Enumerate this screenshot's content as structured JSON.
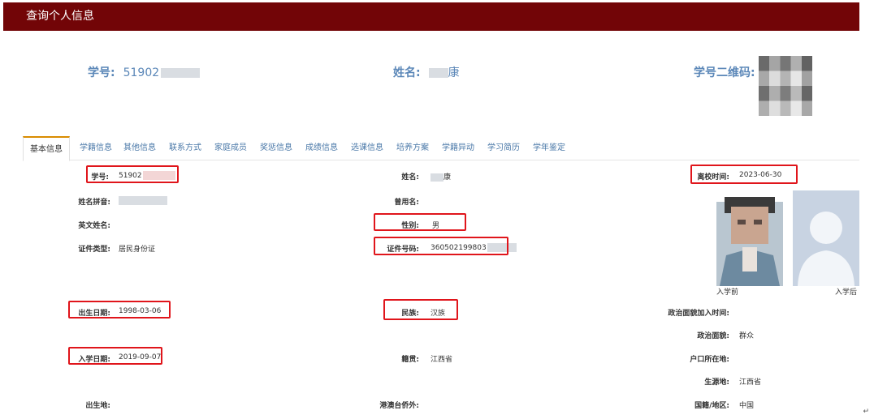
{
  "title": "查询个人信息",
  "header": {
    "student_id_label": "学号:",
    "student_id_value": "51902",
    "name_label": "姓名:",
    "name_value": "康",
    "qr_label": "学号二维码:"
  },
  "tabs": [
    "基本信息",
    "学籍信息",
    "其他信息",
    "联系方式",
    "家庭成员",
    "奖惩信息",
    "成绩信息",
    "选课信息",
    "培养方案",
    "学籍异动",
    "学习简历",
    "学年鉴定"
  ],
  "fields": {
    "student_id": {
      "label": "学号:",
      "value": "51902"
    },
    "name": {
      "label": "姓名:",
      "value": "康"
    },
    "leave_time": {
      "label": "离校时间:",
      "value": "2023-06-30"
    },
    "name_pinyin": {
      "label": "姓名拼音:",
      "value": ""
    },
    "former_name": {
      "label": "曾用名:",
      "value": ""
    },
    "english_name": {
      "label": "英文姓名:",
      "value": ""
    },
    "gender": {
      "label": "性别:",
      "value": "男"
    },
    "id_type": {
      "label": "证件类型:",
      "value": "居民身份证"
    },
    "id_number": {
      "label": "证件号码:",
      "value": "360502199803"
    },
    "birth_date": {
      "label": "出生日期:",
      "value": "1998-03-06"
    },
    "ethnicity": {
      "label": "民族:",
      "value": "汉族"
    },
    "party_join_time": {
      "label": "政治面貌加入时间:",
      "value": ""
    },
    "political_status": {
      "label": "政治面貌:",
      "value": "群众"
    },
    "enroll_date": {
      "label": "入学日期:",
      "value": "2019-09-07"
    },
    "native_place": {
      "label": "籍贯:",
      "value": "江西省"
    },
    "household_location": {
      "label": "户口所在地:",
      "value": ""
    },
    "origin_place": {
      "label": "生源地:",
      "value": "江西省"
    },
    "birthplace": {
      "label": "出生地:",
      "value": ""
    },
    "hk_macao_tw": {
      "label": "港澳台侨外:",
      "value": ""
    },
    "nationality": {
      "label": "国籍/地区:",
      "value": "中国"
    }
  },
  "photos": {
    "before_caption": "入学前",
    "after_caption": "入学后"
  },
  "corner_mark": "↵",
  "colors": {
    "titlebar": "#720507",
    "header_text": "#5b87b8",
    "tab_text": "#4a78a8",
    "highlight": "#e0151b"
  }
}
